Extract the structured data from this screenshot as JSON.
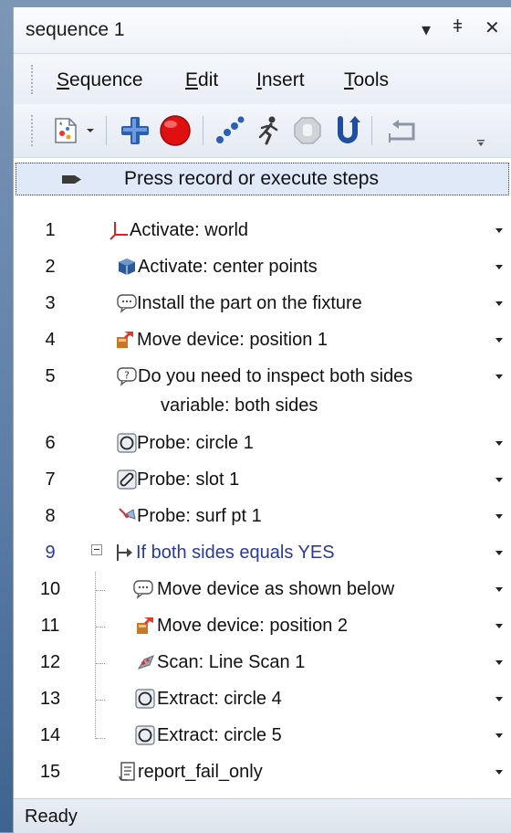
{
  "window": {
    "title": "sequence 1",
    "dropdown_glyph": "▾",
    "pin_glyph": "ǂ",
    "close_glyph": "✕"
  },
  "menu": {
    "items": [
      {
        "ul": "S",
        "rest": "equence"
      },
      {
        "ul": "E",
        "rest": "dit"
      },
      {
        "ul": "I",
        "rest": "nsert"
      },
      {
        "ul": "T",
        "rest": "ools"
      }
    ]
  },
  "toolbar": {
    "icons": [
      "new-sequence-icon",
      "dropdown-arrow-icon",
      "add-step-icon",
      "record-icon",
      "execute-steps-icon",
      "run-icon",
      "stop-icon",
      "undo-icon",
      "wrap-icon"
    ]
  },
  "record_prompt": "Press record or execute steps",
  "steps": [
    {
      "num": "1",
      "label": "Activate: world",
      "icon": "axis-icon"
    },
    {
      "num": "2",
      "label": "Activate: center points",
      "icon": "cube-icon"
    },
    {
      "num": "3",
      "label": "Install the part on the fixture",
      "icon": "message-icon"
    },
    {
      "num": "4",
      "label": "Move device: position 1",
      "icon": "move-device-icon"
    },
    {
      "num": "5",
      "label": "Do you need to inspect both sides",
      "sub": "variable: both sides",
      "icon": "question-icon"
    },
    {
      "num": "6",
      "label": "Probe: circle 1",
      "icon": "circle-probe-icon"
    },
    {
      "num": "7",
      "label": "Probe: slot 1",
      "icon": "slot-probe-icon"
    },
    {
      "num": "8",
      "label": "Probe: surf pt 1",
      "icon": "surface-point-icon"
    },
    {
      "num": "9",
      "label": "If both sides equals YES",
      "icon": "condition-icon"
    },
    {
      "num": "10",
      "label": "Move device as shown below",
      "icon": "message-icon"
    },
    {
      "num": "11",
      "label": "Move device: position 2",
      "icon": "move-device-icon"
    },
    {
      "num": "12",
      "label": "Scan: Line Scan 1",
      "icon": "scan-icon"
    },
    {
      "num": "13",
      "label": "Extract: circle 4",
      "icon": "circle-probe-icon"
    },
    {
      "num": "14",
      "label": "Extract: circle 5",
      "icon": "circle-probe-icon"
    },
    {
      "num": "15",
      "label": "report_fail_only",
      "icon": "report-icon"
    }
  ],
  "status": "Ready",
  "colors": {
    "selected_row": "#dfe9f8",
    "conditional_text": "#2a3a9a",
    "record_red": "#e01010",
    "add_blue": "#2a5fb3"
  }
}
